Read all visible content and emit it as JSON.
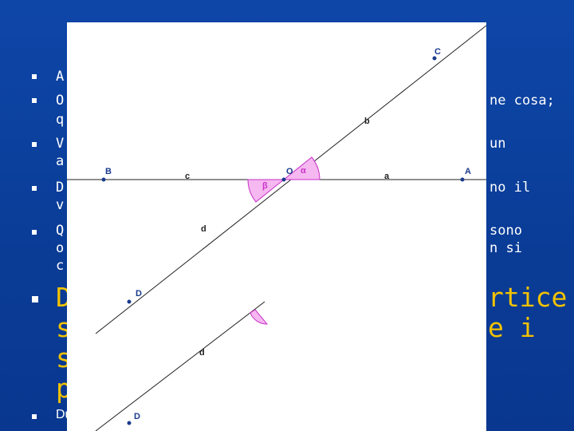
{
  "slide": {
    "lines": [
      {
        "left": "A",
        "right": ""
      },
      {
        "left": "O",
        "right": "ne cosa;"
      },
      {
        "left": "q",
        "right": ""
      },
      {
        "left": "V",
        "right": "un"
      },
      {
        "left": "a",
        "right": ""
      },
      {
        "left": "D",
        "right": "no il"
      },
      {
        "left": "v",
        "right": ""
      },
      {
        "left": "Q",
        "right": "sono"
      },
      {
        "left": "o",
        "right": "n si"
      },
      {
        "left": "c",
        "right": ""
      }
    ],
    "highlight": {
      "line1_left": "D",
      "line1_right": "rtice",
      "line2_left": "se",
      "line2_right": "e i",
      "line3_left": "suc",
      "line4_left": "pro"
    },
    "bottom_text": "Due"
  },
  "geometry": {
    "points": {
      "A": "A",
      "B": "B",
      "C": "C",
      "O": "O",
      "D": "D",
      "D2": "D"
    },
    "segments": {
      "a": "a",
      "b": "b",
      "c": "c",
      "d": "d",
      "d2": "d"
    },
    "angles": {
      "alpha": "α",
      "beta": "β"
    },
    "colors": {
      "point": "#1a3a8c",
      "angle_fill": "#f5b8f0",
      "angle_stroke": "#c830c8",
      "angle_label": "#cc33cc",
      "line": "#222222"
    }
  }
}
